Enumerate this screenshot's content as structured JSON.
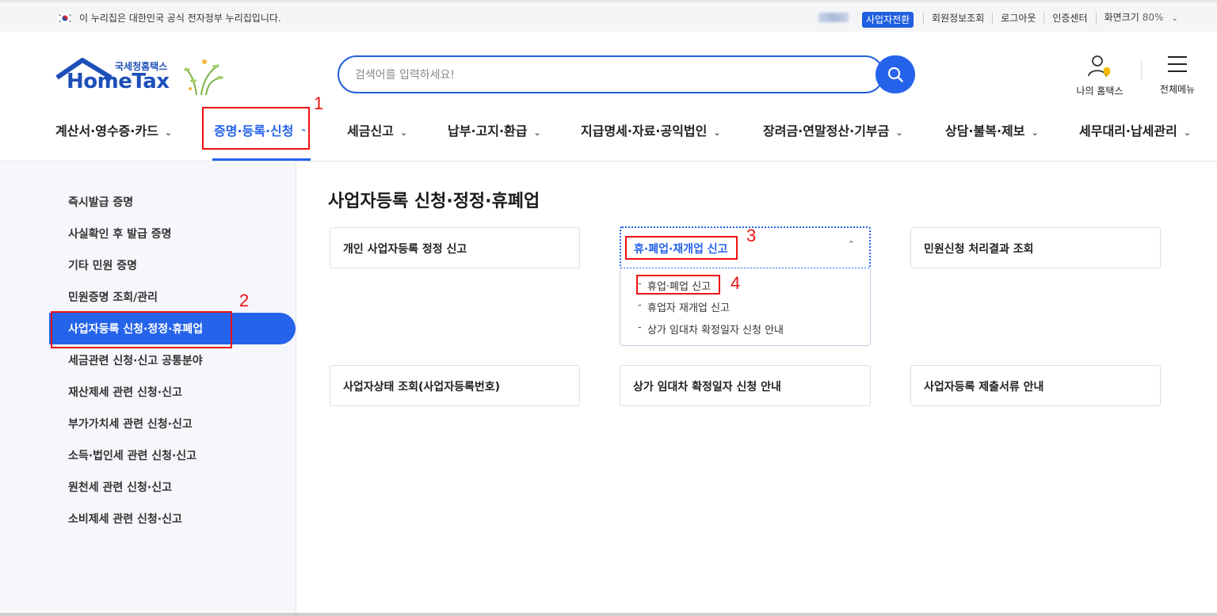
{
  "govbar": {
    "notice": "이 누리집은 대한민국 공식 전자정부 누리집입니다.",
    "biz_switch": "사업자전환",
    "links": [
      "회원정보조회",
      "로그아웃",
      "인증센터"
    ],
    "zoom_label": "화면크기",
    "zoom_value": "80%"
  },
  "logo": {
    "kr": "국세청홈택스",
    "en": "HomeTax"
  },
  "search": {
    "placeholder": "검색어를 입력하세요!"
  },
  "header": {
    "my_hometax": "나의 홈택스",
    "all_menu": "전체메뉴"
  },
  "gnb": {
    "items": [
      "계산서·영수증·카드",
      "증명·등록·신청",
      "세금신고",
      "납부·고지·환급",
      "지급명세·자료·공익법인",
      "장려금·연말정산·기부금",
      "상담·불복·제보",
      "세무대리·납세관리"
    ],
    "active_index": 1
  },
  "sidebar": {
    "items": [
      "즉시발급 증명",
      "사실확인 후 발급 증명",
      "기타 민원 증명",
      "민원증명 조회/관리",
      "사업자등록 신청·정정·휴폐업",
      "세금관련 신청·신고 공통분야",
      "재산제세 관련 신청·신고",
      "부가가치세 관련 신청·신고",
      "소득·법인세 관련 신청·신고",
      "원천세 관련 신청·신고",
      "소비제세 관련 신청·신고"
    ],
    "active_index": 4
  },
  "main": {
    "title": "사업자등록 신청·정정·휴폐업",
    "cards": [
      "개인 사업자등록 정정 신고",
      "휴·폐업·재개업 신고",
      "민원신청 처리결과 조회",
      "사업자상태 조회(사업자등록번호)",
      "상가 임대차 확정일자 신청 안내",
      "사업자등록 제출서류 안내"
    ],
    "submenu": [
      "휴업·폐업 신고",
      "휴업자 재개업 신고",
      "상가 임대차 확정일자 신청 안내"
    ]
  },
  "annotations": [
    "1",
    "2",
    "3",
    "4"
  ],
  "colors": {
    "accent": "#2563eb",
    "annotation": "#ee1111",
    "sidebar_bg": "#f5f7fa"
  }
}
